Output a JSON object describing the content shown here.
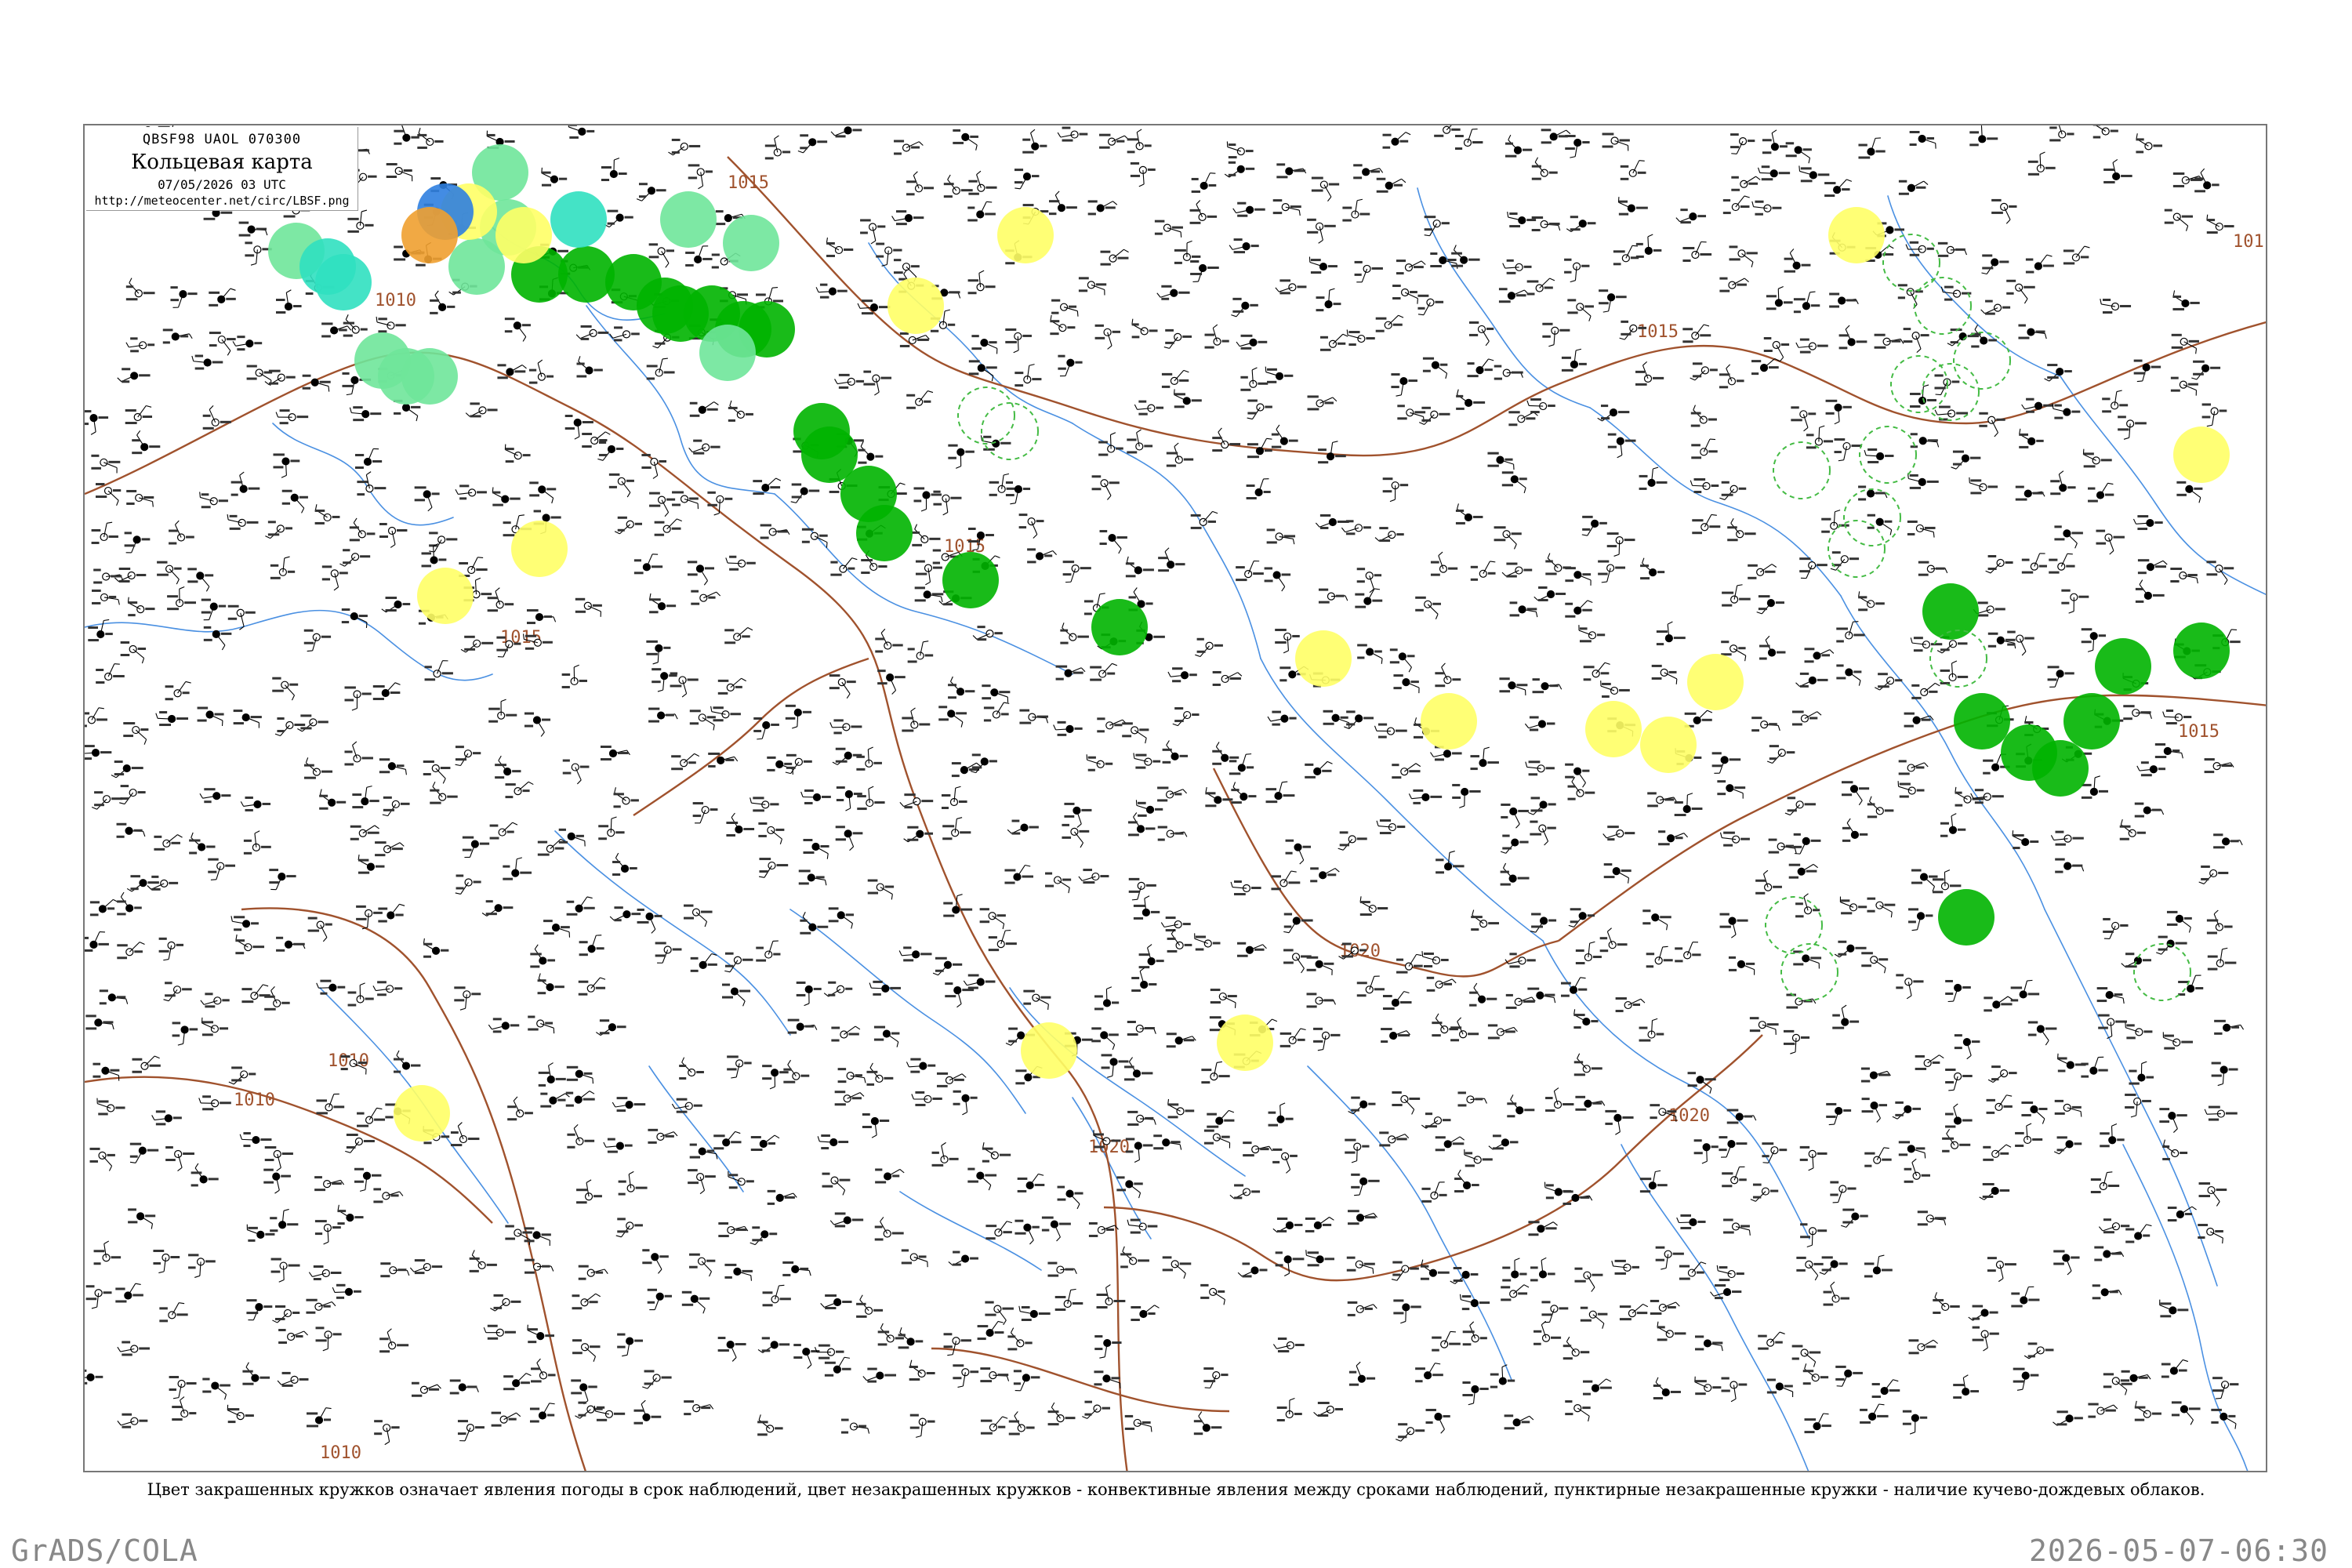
{
  "header": {
    "code": "QBSF98  UAOL  070300",
    "title": "Кольцевая карта",
    "datetime": "07/05/2026 03 UTC",
    "url": "http://meteocenter.net/circ/LBSF.png"
  },
  "isobars": [
    "1010",
    "1010",
    "1010",
    "1010",
    "1015",
    "1015",
    "1015",
    "1015",
    "1015",
    "1020",
    "1020",
    "1020",
    "101"
  ],
  "legend_caption": "Цвет закрашенных кружков означает явления погоды в срок наблюдений, цвет незакрашенных кружков - конвективные явления между сроками наблюдений, пунктирные незакрашенные кружки - наличие кучево-дождевых облаков.",
  "footer": {
    "left": "GrADS/COLA",
    "right": "2026-05-07-06:30"
  },
  "colors": {
    "river": "#4a90e2",
    "isobar": "#a0522d",
    "rain": "#00b400",
    "showers": "#28c940",
    "light_rain": "#6fe59a",
    "drizzle": "#30e0c0",
    "fog": "#ffff66",
    "snow": "#2f7fe0",
    "haze": "#f0a030",
    "cb_dashed": "#44bb44"
  },
  "weather_markers": {
    "rain": 22,
    "light_rain": 10,
    "drizzle": 3,
    "fog_mist": 16,
    "snow": 1,
    "haze": 1,
    "cb_dashed": 15
  }
}
